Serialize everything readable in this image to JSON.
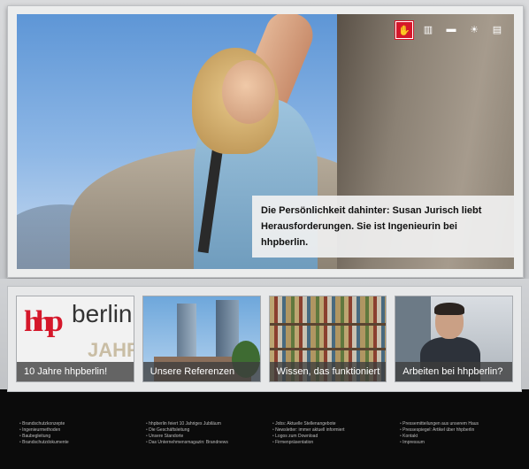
{
  "hero": {
    "caption": "Die Persönlichkeit dahinter: Susan Jurisch liebt Herausforderungen. Sie ist Ingenieurin bei hhpberlin.",
    "toolbar": [
      {
        "icon": "team-icon",
        "glyph": "✋",
        "active": true
      },
      {
        "icon": "building-icon",
        "glyph": "▥",
        "active": false
      },
      {
        "icon": "speech-bubble-icon",
        "glyph": "▬",
        "active": false
      },
      {
        "icon": "lightbulb-icon",
        "glyph": "☀",
        "active": false
      },
      {
        "icon": "briefcase-icon",
        "glyph": "▤",
        "active": false
      }
    ]
  },
  "tiles": [
    {
      "label": "10 Jahre hhpberlin!",
      "logo_text": "hhp",
      "logo_word": "berlin",
      "jahre_text": "JAHR"
    },
    {
      "label": "Unsere Referenzen"
    },
    {
      "label": "Wissen, das funktioniert"
    },
    {
      "label": "Arbeiten bei hhpberlin?"
    }
  ],
  "footer": {
    "columns": [
      [
        "Brandschutzkonzepte",
        "Ingenieurmethoden",
        "Baubegleitung",
        "Brandschutzdokumente"
      ],
      [
        "hhpberlin feiert 10 Jahriges Jubiläum",
        "Die Geschäftsleitung",
        "Unsere Standorte",
        "Das Unternehmensmagazin: Brandnews"
      ],
      [
        "Jobs: Aktuelle Stellenangebote",
        "Newsletter: immer aktuell informiert",
        "Logos zum Download",
        "Firmenpräsentation"
      ],
      [
        "Pressemitteilungen aus unserem Haus",
        "Pressespiegel: Artikel über hhpberlin",
        "Kontakt",
        "Impressum"
      ]
    ]
  },
  "colors": {
    "accent": "#d5172a"
  }
}
